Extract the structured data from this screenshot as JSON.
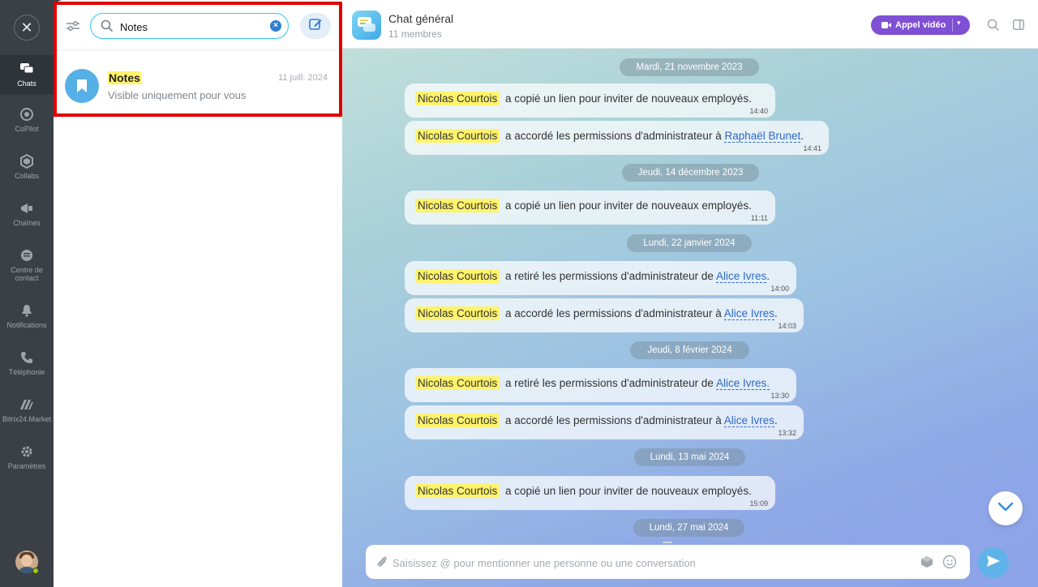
{
  "rail": {
    "items": [
      {
        "label": "Chats",
        "icon": "chat-bubbles-icon"
      },
      {
        "label": "CoPilot",
        "icon": "copilot-icon"
      },
      {
        "label": "Collabs",
        "icon": "hexagon-icon"
      },
      {
        "label": "Chaînes",
        "icon": "megaphone-icon"
      },
      {
        "label": "Centre de contact",
        "icon": "contact-center-icon"
      },
      {
        "label": "Notifications",
        "icon": "bell-icon"
      },
      {
        "label": "Téléphonie",
        "icon": "phone-icon"
      },
      {
        "label": "Bitrix24.Market",
        "icon": "market-icon"
      },
      {
        "label": "Paramètres",
        "icon": "gear-icon"
      }
    ]
  },
  "search": {
    "value": "Notes"
  },
  "results": [
    {
      "name": "Notes",
      "date": "11 juill. 2024",
      "subtitle": "Visible uniquement pour vous"
    }
  ],
  "chat": {
    "title": "Chat général",
    "members": "11 membres",
    "video_label": "Appel vidéo",
    "composer_placeholder": "Saisissez @ pour mentionner une personne ou une conversation"
  },
  "dates": [
    "Mardi, 21 novembre 2023",
    "Jeudi, 14 décembre 2023",
    "Lundi, 22 janvier 2024",
    "Jeudi, 8 février 2024",
    "Lundi, 13 mai 2024",
    "Lundi, 27 mai 2024"
  ],
  "messages": [
    {
      "author": "Nicolas Courtois",
      "text": "a copié un lien pour inviter de nouveaux employés.",
      "link": "",
      "suffix": "",
      "time": "14:40"
    },
    {
      "author": "Nicolas Courtois",
      "text": "a accordé les permissions d'administrateur à ",
      "link": "Raphaël Brunet",
      "suffix": ".",
      "time": "14:41"
    },
    {
      "author": "Nicolas Courtois",
      "text": "a copié un lien pour inviter de nouveaux employés.",
      "link": "",
      "suffix": "",
      "time": "11:11"
    },
    {
      "author": "Nicolas Courtois",
      "text": "a retiré les permissions d'administrateur de ",
      "link": "Alice Ivres",
      "suffix": ".",
      "time": "14:00"
    },
    {
      "author": "Nicolas Courtois",
      "text": "a accordé les permissions d'administrateur à ",
      "link": "Alice Ivres",
      "suffix": ".",
      "time": "14:03"
    },
    {
      "author": "Nicolas Courtois",
      "text": "a retiré les permissions d'administrateur de ",
      "link": "Alice Ivres.",
      "suffix": "",
      "time": "13:30"
    },
    {
      "author": "Nicolas Courtois",
      "text": "a accordé les permissions d'administrateur à ",
      "link": "Alice Ivres",
      "suffix": ".",
      "time": "13:32"
    },
    {
      "author": "Nicolas Courtois",
      "text": "a copié un lien pour inviter de nouveaux employés.",
      "link": "",
      "suffix": "",
      "time": "15:09"
    }
  ],
  "colors": {
    "accent": "#2fc6f6",
    "video_button": "#7f4fd4",
    "highlight": "#fff36b",
    "frame": "#e00000"
  }
}
